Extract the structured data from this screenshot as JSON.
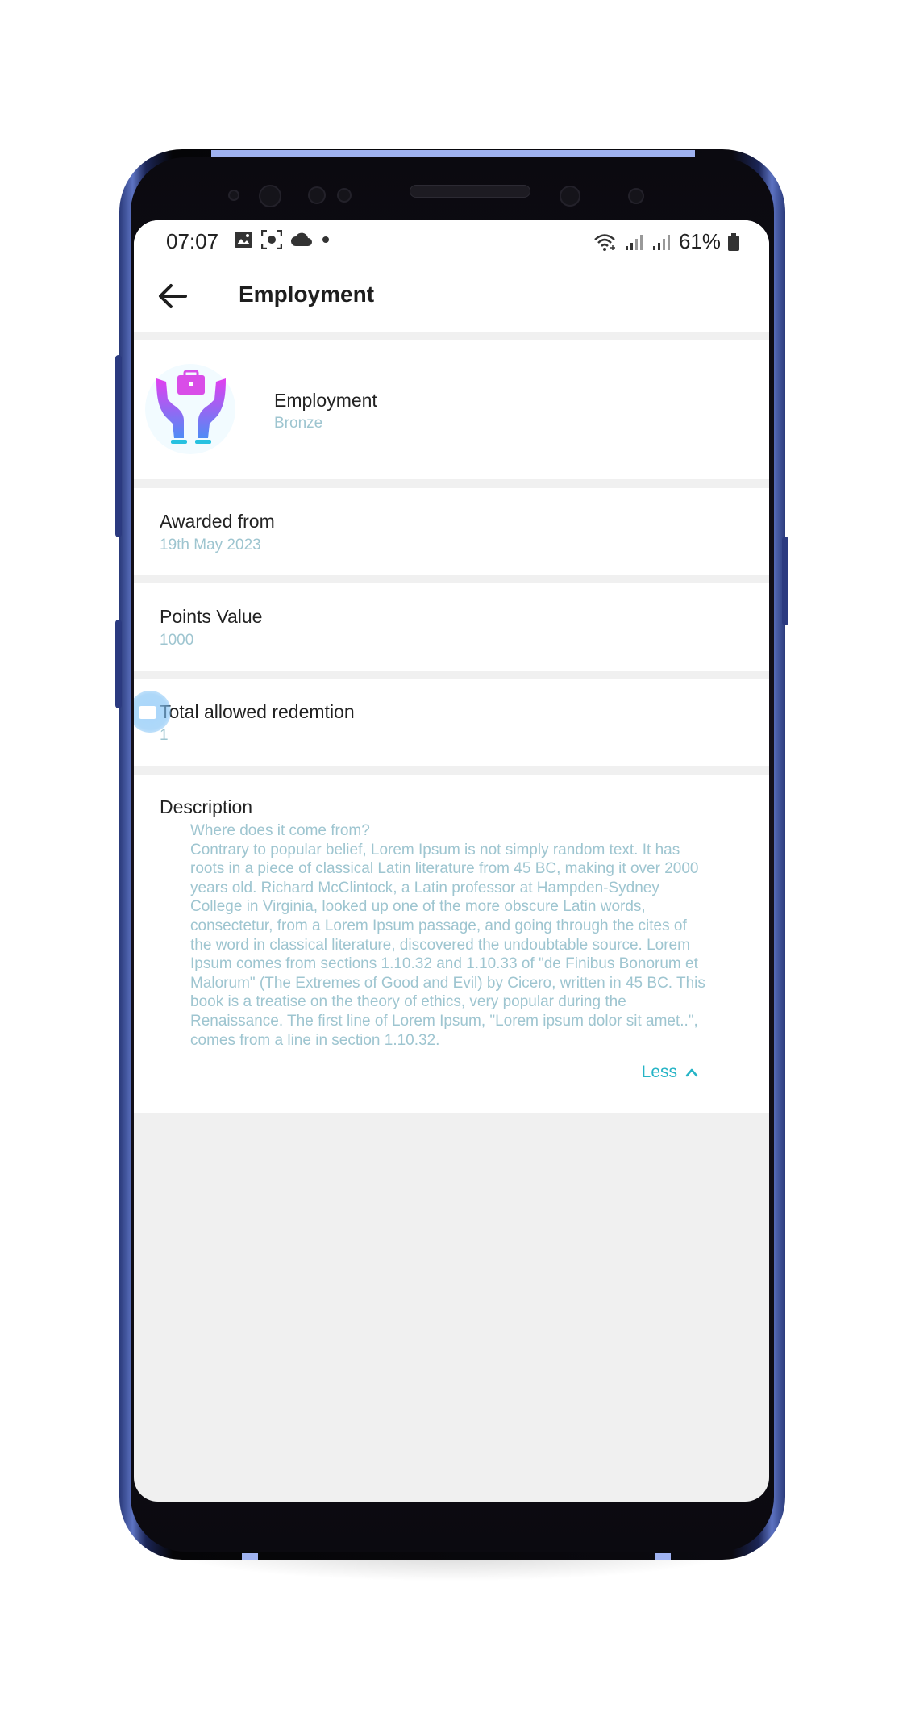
{
  "status_bar": {
    "time": "07:07",
    "left_icons": [
      "gallery-icon",
      "screenshot-icon",
      "cloud-icon",
      "dot-icon"
    ],
    "right_icons": [
      "wifi-icon",
      "signal-icon",
      "signal-icon"
    ],
    "battery_text": "61%"
  },
  "app_bar": {
    "back_icon": "arrow-left-icon",
    "title": "Employment"
  },
  "badge": {
    "icon": "hands-briefcase-icon",
    "name": "Employment",
    "level": "Bronze"
  },
  "details": {
    "awarded": {
      "label": "Awarded from",
      "value": "19th May 2023"
    },
    "points": {
      "label": "Points Value",
      "value": "1000"
    },
    "redemption": {
      "label": "Total allowed redemtion",
      "value": "1"
    }
  },
  "description": {
    "heading": "Description",
    "text": "Where does it come from?\nContrary to popular belief, Lorem Ipsum is not simply random text. It has roots in a piece of classical Latin literature from 45 BC, making it over 2000 years old. Richard McClintock, a Latin professor at Hampden-Sydney College in Virginia, looked up one of the more obscure Latin words, consectetur, from a Lorem Ipsum passage, and going through the cites of the word in classical literature, discovered the undoubtable source. Lorem Ipsum comes from sections 1.10.32 and 1.10.33 of \"de Finibus Bonorum et Malorum\" (The Extremes of Good and Evil) by Cicero, written in 45 BC. This book is a treatise on the theory of ethics, very popular during the Renaissance. The first line of Lorem Ipsum, \"Lorem ipsum dolor sit amet..\", comes from a line in section 1.10.32.",
    "less_label": "Less",
    "less_icon": "chevron-up-icon"
  },
  "colors": {
    "accent": "#26b4c6",
    "muted_value": "#9ec5d0",
    "frame": "#2b3a80",
    "background": "#f0f0f0"
  }
}
